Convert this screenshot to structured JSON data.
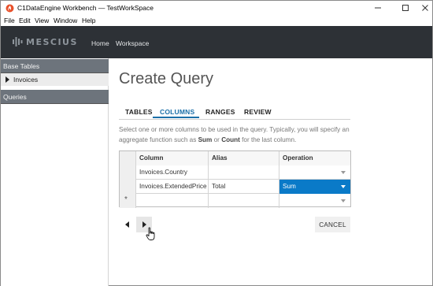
{
  "window": {
    "title": "C1DataEngine Workbench — TestWorkSpace",
    "icon": "app-flame-icon",
    "controls": [
      "minimize-icon",
      "maximize-icon",
      "close-icon"
    ]
  },
  "menu": {
    "items": [
      "File",
      "Edit",
      "View",
      "Window",
      "Help"
    ]
  },
  "header": {
    "brand": "MESCIUS",
    "nav": [
      "Home",
      "Workspace"
    ]
  },
  "sidebar": {
    "sections": [
      {
        "label": "Base Tables",
        "items": [
          "Invoices"
        ]
      },
      {
        "label": "Queries",
        "items": []
      }
    ]
  },
  "main": {
    "title": "Create Query",
    "tabs": [
      {
        "label": "TABLES",
        "active": false
      },
      {
        "label": "COLUMNS",
        "active": true
      },
      {
        "label": "RANGES",
        "active": false
      },
      {
        "label": "REVIEW",
        "active": false
      }
    ],
    "instructions": {
      "part1": "Select one or more columns to be used in the query. Typically, you will specify an aggregate function such as ",
      "bold1": "Sum",
      "part2": " or ",
      "bold2": "Count",
      "part3": " for the last column."
    },
    "grid": {
      "headers": [
        "Column",
        "Alias",
        "Operation"
      ],
      "rows": [
        {
          "column": "Invoices.Country",
          "alias": "",
          "operation": ""
        },
        {
          "column": "Invoices.ExtendedPrice",
          "alias": "Total",
          "operation": "Sum"
        }
      ],
      "new_row_marker": "*"
    },
    "buttons": {
      "cancel": "CANCEL"
    }
  },
  "colors": {
    "header_bg": "#2d3136",
    "sidebar_head_bg": "#6d747c",
    "accent": "#1b6fa8",
    "selection": "#0a7ac8"
  }
}
